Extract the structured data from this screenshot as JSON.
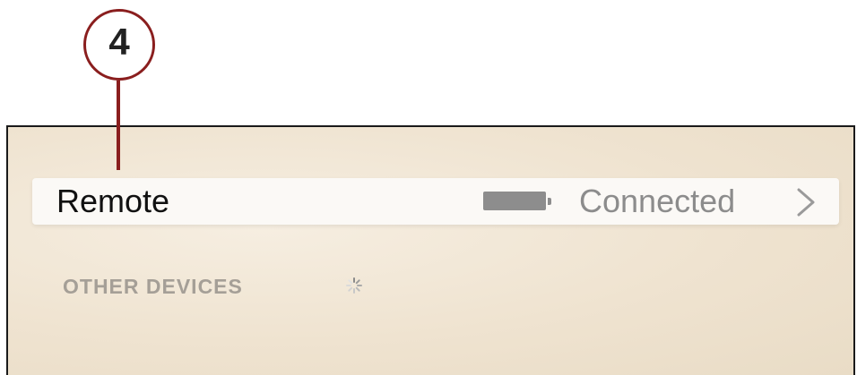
{
  "callout": {
    "number": "4"
  },
  "remote_row": {
    "label": "Remote",
    "status": "Connected",
    "battery_icon": "battery-icon",
    "chevron_icon": "chevron-right-icon"
  },
  "other_devices": {
    "header": "OTHER DEVICES",
    "spinner_icon": "loading-spinner-icon"
  },
  "colors": {
    "callout_accent": "#8a1e1e",
    "background": "#efe3d0",
    "row_background": "#fbf9f6",
    "status_gray": "#8c8c8c",
    "section_header": "#a59f97"
  }
}
